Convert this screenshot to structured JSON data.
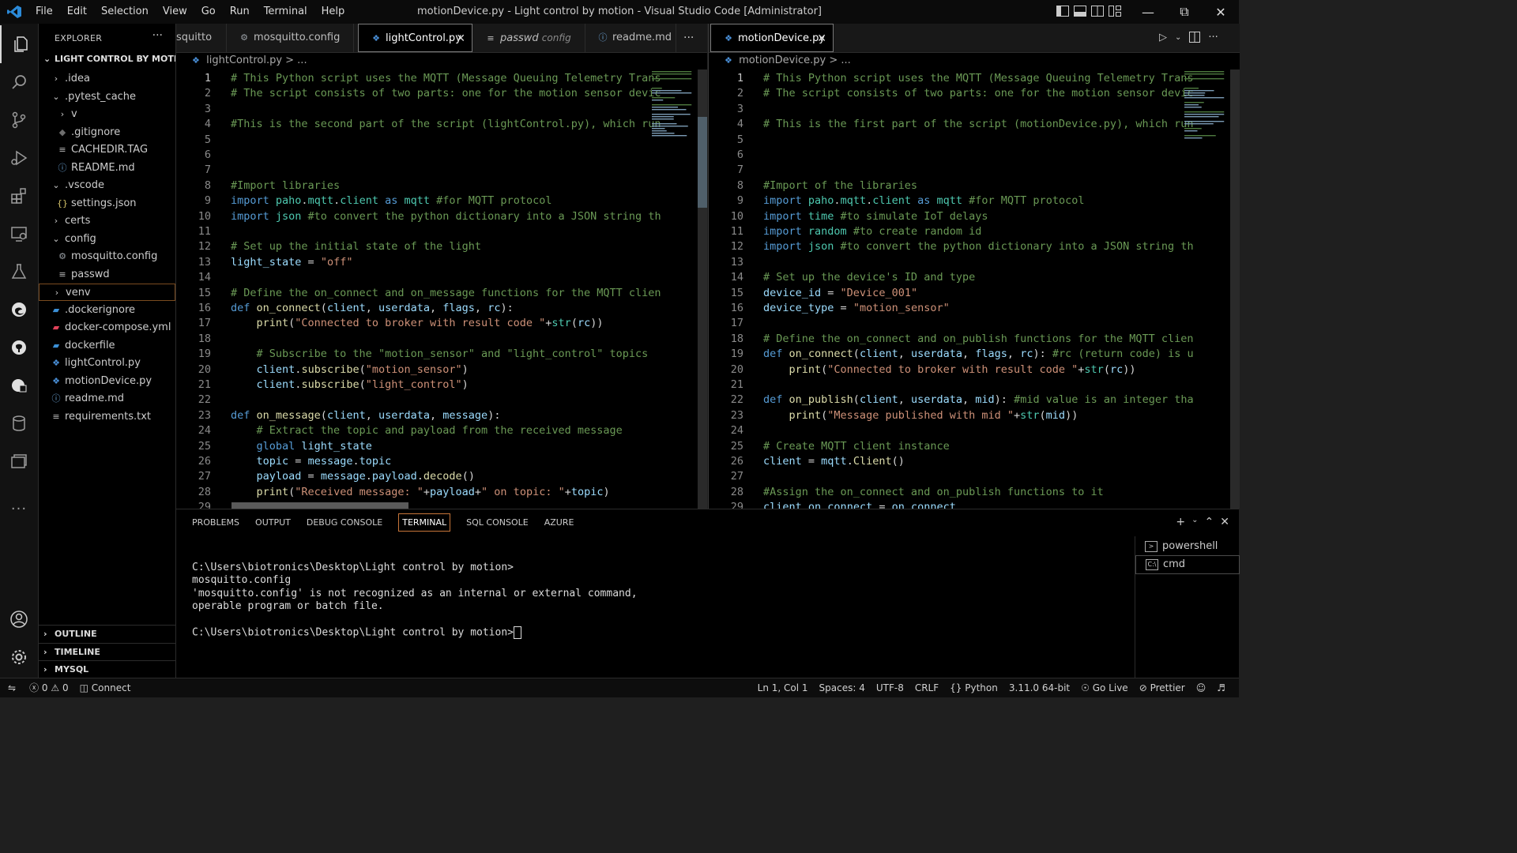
{
  "titlebar": {
    "menu": [
      "File",
      "Edit",
      "Selection",
      "View",
      "Go",
      "Run",
      "Terminal",
      "Help"
    ],
    "title": "motionDevice.py - Light control by motion - Visual Studio Code [Administrator]"
  },
  "sidebar": {
    "header": "EXPLORER",
    "root": "LIGHT CONTROL BY MOTI...",
    "tree": [
      {
        "label": ".idea",
        "indent": 1,
        "type": "folder-closed"
      },
      {
        "label": ".pytest_cache",
        "indent": 1,
        "type": "folder-open"
      },
      {
        "label": "v",
        "indent": 2,
        "type": "folder-closed"
      },
      {
        "label": ".gitignore",
        "indent": 2,
        "type": "git"
      },
      {
        "label": "CACHEDIR.TAG",
        "indent": 2,
        "type": "lines"
      },
      {
        "label": "README.md",
        "indent": 2,
        "type": "info"
      },
      {
        "label": ".vscode",
        "indent": 1,
        "type": "folder-open"
      },
      {
        "label": "settings.json",
        "indent": 2,
        "type": "json"
      },
      {
        "label": "certs",
        "indent": 1,
        "type": "folder-closed"
      },
      {
        "label": "config",
        "indent": 1,
        "type": "folder-open"
      },
      {
        "label": "mosquitto.config",
        "indent": 2,
        "type": "gear"
      },
      {
        "label": "passwd",
        "indent": 2,
        "type": "lines"
      },
      {
        "label": "venv",
        "indent": 1,
        "type": "folder-closed"
      },
      {
        "label": ".dockerignore",
        "indent": 1,
        "type": "docker"
      },
      {
        "label": "docker-compose.yml",
        "indent": 1,
        "type": "compose"
      },
      {
        "label": "dockerfile",
        "indent": 1,
        "type": "docker"
      },
      {
        "label": "lightControl.py",
        "indent": 1,
        "type": "python"
      },
      {
        "label": "motionDevice.py",
        "indent": 1,
        "type": "python"
      },
      {
        "label": "readme.md",
        "indent": 1,
        "type": "info"
      },
      {
        "label": "requirements.txt",
        "indent": 1,
        "type": "lines"
      }
    ],
    "sections": [
      "OUTLINE",
      "TIMELINE",
      "MYSQL"
    ]
  },
  "left_editor": {
    "tabs": [
      {
        "label": "squitto",
        "icon": ""
      },
      {
        "label": "mosquitto.config",
        "icon": "gear-icon"
      },
      {
        "label": "lightControl.py",
        "icon": "python-icon",
        "close": "✕"
      },
      {
        "label": "passwd",
        "sub": "config",
        "icon": "lines-icon"
      },
      {
        "label": "readme.md",
        "icon": "info-icon"
      }
    ],
    "more": "···",
    "breadcrumb": "lightControl.py > ...",
    "lines": [
      {
        "n": "1",
        "code": [
          [
            "c",
            "# This Python script uses the MQTT (Message Queuing Telemetry Trans"
          ]
        ]
      },
      {
        "n": "2",
        "code": [
          [
            "c",
            "# The script consists of two parts: one for the motion sensor devic"
          ]
        ]
      },
      {
        "n": "3",
        "code": []
      },
      {
        "n": "4",
        "code": [
          [
            "c",
            "#This is the second part of the script (lightControl.py), which run"
          ]
        ]
      },
      {
        "n": "5",
        "code": []
      },
      {
        "n": "6",
        "code": []
      },
      {
        "n": "7",
        "code": []
      },
      {
        "n": "8",
        "code": [
          [
            "c",
            "#Import libraries"
          ]
        ]
      },
      {
        "n": "9",
        "code": [
          [
            "k",
            "import "
          ],
          [
            "m",
            "paho"
          ],
          [
            "p",
            "."
          ],
          [
            "m",
            "mqtt"
          ],
          [
            "p",
            "."
          ],
          [
            "m",
            "client"
          ],
          [
            "k",
            " as "
          ],
          [
            "m",
            "mqtt "
          ],
          [
            "c",
            "#for MQTT protocol"
          ]
        ]
      },
      {
        "n": "10",
        "code": [
          [
            "k",
            "import "
          ],
          [
            "m",
            "json "
          ],
          [
            "c",
            "#to convert the python dictionary into a JSON string th"
          ]
        ]
      },
      {
        "n": "11",
        "code": []
      },
      {
        "n": "12",
        "code": [
          [
            "c",
            "# Set up the initial state of the light"
          ]
        ]
      },
      {
        "n": "13",
        "code": [
          [
            "v",
            "light_state "
          ],
          [
            "p",
            "= "
          ],
          [
            "s",
            "\"off\""
          ]
        ]
      },
      {
        "n": "14",
        "code": []
      },
      {
        "n": "15",
        "code": [
          [
            "c",
            "# Define the on_connect and on_message functions for the MQTT clien"
          ]
        ]
      },
      {
        "n": "16",
        "code": [
          [
            "k",
            "def "
          ],
          [
            "f",
            "on_connect"
          ],
          [
            "p",
            "("
          ],
          [
            "v",
            "client"
          ],
          [
            "p",
            ", "
          ],
          [
            "v",
            "userdata"
          ],
          [
            "p",
            ", "
          ],
          [
            "v",
            "flags"
          ],
          [
            "p",
            ", "
          ],
          [
            "v",
            "rc"
          ],
          [
            "p",
            "):"
          ]
        ]
      },
      {
        "n": "17",
        "code": [
          [
            "p",
            "    "
          ],
          [
            "f",
            "print"
          ],
          [
            "p",
            "("
          ],
          [
            "s",
            "\"Connected to broker with result code \""
          ],
          [
            "p",
            "+"
          ],
          [
            "m",
            "str"
          ],
          [
            "p",
            "("
          ],
          [
            "v",
            "rc"
          ],
          [
            "p",
            "))"
          ]
        ]
      },
      {
        "n": "18",
        "code": []
      },
      {
        "n": "19",
        "code": [
          [
            "p",
            "    "
          ],
          [
            "c",
            "# Subscribe to the \"motion_sensor\" and \"light_control\" topics"
          ]
        ]
      },
      {
        "n": "20",
        "code": [
          [
            "p",
            "    "
          ],
          [
            "v",
            "client"
          ],
          [
            "p",
            "."
          ],
          [
            "f",
            "subscribe"
          ],
          [
            "p",
            "("
          ],
          [
            "s",
            "\"motion_sensor\""
          ],
          [
            "p",
            ")"
          ]
        ]
      },
      {
        "n": "21",
        "code": [
          [
            "p",
            "    "
          ],
          [
            "v",
            "client"
          ],
          [
            "p",
            "."
          ],
          [
            "f",
            "subscribe"
          ],
          [
            "p",
            "("
          ],
          [
            "s",
            "\"light_control\""
          ],
          [
            "p",
            ")"
          ]
        ]
      },
      {
        "n": "22",
        "code": []
      },
      {
        "n": "23",
        "code": [
          [
            "k",
            "def "
          ],
          [
            "f",
            "on_message"
          ],
          [
            "p",
            "("
          ],
          [
            "v",
            "client"
          ],
          [
            "p",
            ", "
          ],
          [
            "v",
            "userdata"
          ],
          [
            "p",
            ", "
          ],
          [
            "v",
            "message"
          ],
          [
            "p",
            "):"
          ]
        ]
      },
      {
        "n": "24",
        "code": [
          [
            "p",
            "    "
          ],
          [
            "c",
            "# Extract the topic and payload from the received message"
          ]
        ]
      },
      {
        "n": "25",
        "code": [
          [
            "p",
            "    "
          ],
          [
            "k",
            "global "
          ],
          [
            "v",
            "light_state"
          ]
        ]
      },
      {
        "n": "26",
        "code": [
          [
            "p",
            "    "
          ],
          [
            "v",
            "topic "
          ],
          [
            "p",
            "= "
          ],
          [
            "v",
            "message"
          ],
          [
            "p",
            "."
          ],
          [
            "v",
            "topic"
          ]
        ]
      },
      {
        "n": "27",
        "code": [
          [
            "p",
            "    "
          ],
          [
            "v",
            "payload "
          ],
          [
            "p",
            "= "
          ],
          [
            "v",
            "message"
          ],
          [
            "p",
            "."
          ],
          [
            "v",
            "payload"
          ],
          [
            "p",
            "."
          ],
          [
            "f",
            "decode"
          ],
          [
            "p",
            "()"
          ]
        ]
      },
      {
        "n": "28",
        "code": [
          [
            "p",
            "    "
          ],
          [
            "f",
            "print"
          ],
          [
            "p",
            "("
          ],
          [
            "s",
            "\"Received message: \""
          ],
          [
            "p",
            "+"
          ],
          [
            "v",
            "payload"
          ],
          [
            "p",
            "+"
          ],
          [
            "s",
            "\" on topic: \""
          ],
          [
            "p",
            "+"
          ],
          [
            "v",
            "topic"
          ],
          [
            "p",
            ")"
          ]
        ]
      },
      {
        "n": "29",
        "code": []
      }
    ]
  },
  "right_editor": {
    "tabs": [
      {
        "label": "motionDevice.py",
        "icon": "python-icon",
        "close": "✕"
      }
    ],
    "breadcrumb": "motionDevice.py > ...",
    "lines": [
      {
        "n": "1",
        "code": [
          [
            "c",
            "# This Python script uses the MQTT (Message Queuing Telemetry Trans"
          ]
        ]
      },
      {
        "n": "2",
        "code": [
          [
            "c",
            "# The script consists of two parts: one for the motion sensor devic"
          ]
        ]
      },
      {
        "n": "3",
        "code": []
      },
      {
        "n": "4",
        "code": [
          [
            "c",
            "# This is the first part of the script (motionDevice.py), which run"
          ]
        ]
      },
      {
        "n": "5",
        "code": []
      },
      {
        "n": "6",
        "code": []
      },
      {
        "n": "7",
        "code": []
      },
      {
        "n": "8",
        "code": [
          [
            "c",
            "#Import of the libraries"
          ]
        ]
      },
      {
        "n": "9",
        "code": [
          [
            "k",
            "import "
          ],
          [
            "m",
            "paho"
          ],
          [
            "p",
            "."
          ],
          [
            "m",
            "mqtt"
          ],
          [
            "p",
            "."
          ],
          [
            "m",
            "client"
          ],
          [
            "k",
            " as "
          ],
          [
            "m",
            "mqtt "
          ],
          [
            "c",
            "#for MQTT protocol"
          ]
        ]
      },
      {
        "n": "10",
        "code": [
          [
            "k",
            "import "
          ],
          [
            "m",
            "time "
          ],
          [
            "c",
            "#to simulate IoT delays"
          ]
        ]
      },
      {
        "n": "11",
        "code": [
          [
            "k",
            "import "
          ],
          [
            "m",
            "random "
          ],
          [
            "c",
            "#to create random id"
          ]
        ]
      },
      {
        "n": "12",
        "code": [
          [
            "k",
            "import "
          ],
          [
            "m",
            "json "
          ],
          [
            "c",
            "#to convert the python dictionary into a JSON string th"
          ]
        ]
      },
      {
        "n": "13",
        "code": []
      },
      {
        "n": "14",
        "code": [
          [
            "c",
            "# Set up the device's ID and type"
          ]
        ]
      },
      {
        "n": "15",
        "code": [
          [
            "v",
            "device_id "
          ],
          [
            "p",
            "= "
          ],
          [
            "s",
            "\"Device_001\""
          ]
        ]
      },
      {
        "n": "16",
        "code": [
          [
            "v",
            "device_type "
          ],
          [
            "p",
            "= "
          ],
          [
            "s",
            "\"motion_sensor\""
          ]
        ]
      },
      {
        "n": "17",
        "code": []
      },
      {
        "n": "18",
        "code": [
          [
            "c",
            "# Define the on_connect and on_publish functions for the MQTT clien"
          ]
        ]
      },
      {
        "n": "19",
        "code": [
          [
            "k",
            "def "
          ],
          [
            "f",
            "on_connect"
          ],
          [
            "p",
            "("
          ],
          [
            "v",
            "client"
          ],
          [
            "p",
            ", "
          ],
          [
            "v",
            "userdata"
          ],
          [
            "p",
            ", "
          ],
          [
            "v",
            "flags"
          ],
          [
            "p",
            ", "
          ],
          [
            "v",
            "rc"
          ],
          [
            "p",
            "): "
          ],
          [
            "c",
            "#rc (return code) is u"
          ]
        ]
      },
      {
        "n": "20",
        "code": [
          [
            "p",
            "    "
          ],
          [
            "f",
            "print"
          ],
          [
            "p",
            "("
          ],
          [
            "s",
            "\"Connected to broker with result code \""
          ],
          [
            "p",
            "+"
          ],
          [
            "m",
            "str"
          ],
          [
            "p",
            "("
          ],
          [
            "v",
            "rc"
          ],
          [
            "p",
            "))"
          ]
        ]
      },
      {
        "n": "21",
        "code": []
      },
      {
        "n": "22",
        "code": [
          [
            "k",
            "def "
          ],
          [
            "f",
            "on_publish"
          ],
          [
            "p",
            "("
          ],
          [
            "v",
            "client"
          ],
          [
            "p",
            ", "
          ],
          [
            "v",
            "userdata"
          ],
          [
            "p",
            ", "
          ],
          [
            "v",
            "mid"
          ],
          [
            "p",
            "): "
          ],
          [
            "c",
            "#mid value is an integer tha"
          ]
        ]
      },
      {
        "n": "23",
        "code": [
          [
            "p",
            "    "
          ],
          [
            "f",
            "print"
          ],
          [
            "p",
            "("
          ],
          [
            "s",
            "\"Message published with mid \""
          ],
          [
            "p",
            "+"
          ],
          [
            "m",
            "str"
          ],
          [
            "p",
            "("
          ],
          [
            "v",
            "mid"
          ],
          [
            "p",
            "))"
          ]
        ]
      },
      {
        "n": "24",
        "code": []
      },
      {
        "n": "25",
        "code": [
          [
            "c",
            "# Create MQTT client instance"
          ]
        ]
      },
      {
        "n": "26",
        "code": [
          [
            "v",
            "client "
          ],
          [
            "p",
            "= "
          ],
          [
            "v",
            "mqtt"
          ],
          [
            "p",
            "."
          ],
          [
            "f",
            "Client"
          ],
          [
            "p",
            "()"
          ]
        ]
      },
      {
        "n": "27",
        "code": []
      },
      {
        "n": "28",
        "code": [
          [
            "c",
            "#Assign the on_connect and on_publish functions to it"
          ]
        ]
      },
      {
        "n": "29",
        "code": [
          [
            "v",
            "client"
          ],
          [
            "p",
            "."
          ],
          [
            "v",
            "on_connect "
          ],
          [
            "p",
            "= "
          ],
          [
            "v",
            "on_connect"
          ]
        ]
      }
    ]
  },
  "panel": {
    "tabs": [
      "PROBLEMS",
      "OUTPUT",
      "DEBUG CONSOLE",
      "TERMINAL",
      "SQL CONSOLE",
      "AZURE"
    ],
    "active_tab": "TERMINAL",
    "terminal_lines": [
      "C:\\Users\\biotronics\\Desktop\\Light control by motion>",
      "mosquitto.config",
      "'mosquitto.config' is not recognized as an internal or external command,",
      "operable program or batch file.",
      "",
      "C:\\Users\\biotronics\\Desktop\\Light control by motion>"
    ],
    "terminals": [
      "powershell",
      "cmd"
    ]
  },
  "statusbar": {
    "problems_errors": "0",
    "problems_warnings": "0",
    "connect": "Connect",
    "position": "Ln 1, Col 1",
    "spaces": "Spaces: 4",
    "encoding": "UTF-8",
    "eol": "CRLF",
    "language": "Python",
    "interpreter": "3.11.0 64-bit",
    "golive": "Go Live",
    "prettier": "Prettier"
  }
}
